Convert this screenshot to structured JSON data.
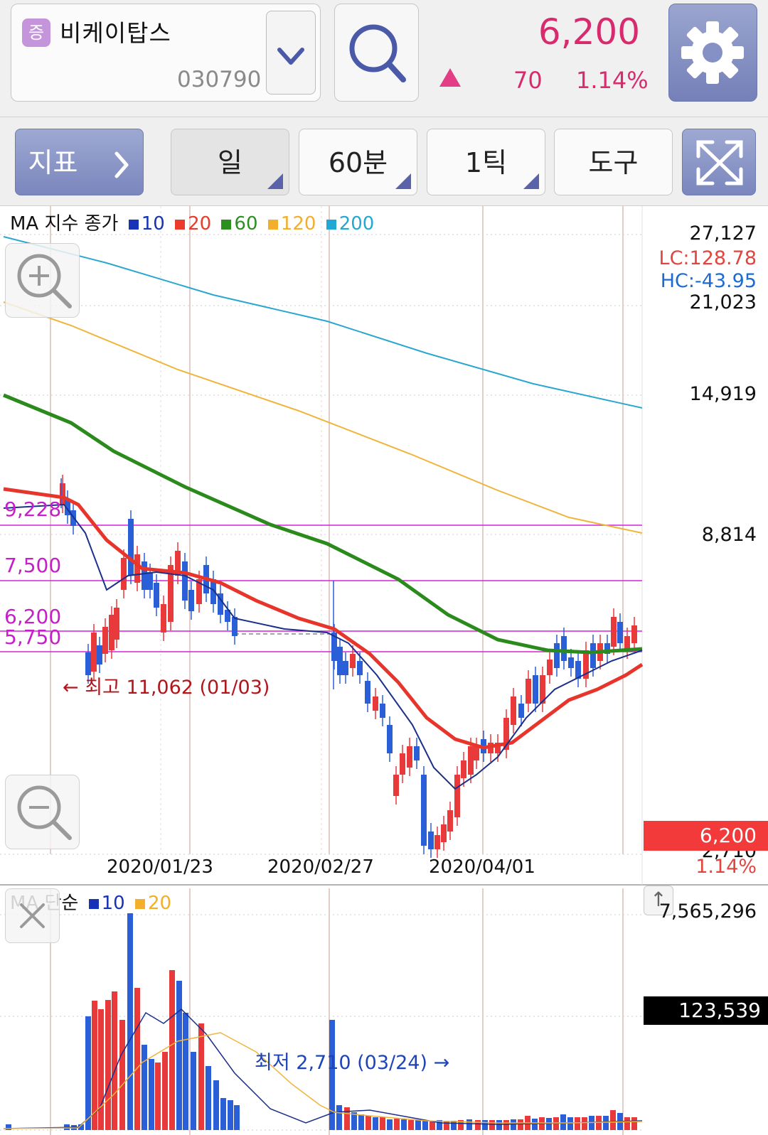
{
  "header": {
    "market_badge": "증",
    "stock_name": "비케이탑스",
    "stock_code": "030790",
    "price": "6,200",
    "change": "70",
    "change_pct": "1.14%"
  },
  "toolbar": {
    "indicator_label": "지표",
    "period_day": "일",
    "period_60min": "60분",
    "tick": "1틱",
    "tools": "도구"
  },
  "colors": {
    "up": "#e8393b",
    "down": "#2a5fd8",
    "ma10": "#1b2f8c",
    "ma20": "#e8352c",
    "ma60": "#2b8a1c",
    "ma120": "#f0b43a",
    "ma200": "#2aa7d0",
    "support_line": "#d622d8"
  },
  "price_legend": {
    "title": "MA 지수 종가",
    "items": [
      {
        "label": "10",
        "color": "#1733b8"
      },
      {
        "label": "20",
        "color": "#ea3b2b"
      },
      {
        "label": "60",
        "color": "#2e8f21"
      },
      {
        "label": "120",
        "color": "#f3ae2c"
      },
      {
        "label": "200",
        "color": "#21a9d3"
      }
    ]
  },
  "volume_legend": {
    "title": "MA 단순",
    "items": [
      {
        "label": "10",
        "color": "#1733b8"
      },
      {
        "label": "20",
        "color": "#f3ae2c"
      }
    ]
  },
  "y_axis": {
    "top": "27,127",
    "lc": "LC:128.78",
    "hc": "HC:-43.95",
    "l2": "21,023",
    "l3": "14,919",
    "l4": "8,814",
    "bottom": "2,710",
    "current": "6,200",
    "current_pct": "1.14%"
  },
  "volume_axis": {
    "top": "7,565,296",
    "current": "123,539"
  },
  "price_labels": {
    "p1": "9,228",
    "p2": "7,500",
    "p3": "6,200",
    "p4": "5,750"
  },
  "x_axis": {
    "d1": "2020/01/23",
    "d2": "2020/02/27",
    "d3": "2020/04/01"
  },
  "annotations": {
    "high": "← 최고 11,062 (01/03)",
    "low": "최저 2,710 (03/24) →"
  },
  "chart_data": {
    "type": "candlestick",
    "title": "",
    "x": [
      "2020/01/23",
      "2020/02/27",
      "2020/04/01"
    ],
    "series": [
      {
        "name": "10",
        "values": []
      },
      {
        "name": "20",
        "values": []
      },
      {
        "name": "60",
        "values": []
      },
      {
        "name": "120",
        "values": []
      },
      {
        "name": "200",
        "values": []
      }
    ],
    "ylim": [
      2710,
      27127
    ],
    "y_ticks": [
      27127,
      21023,
      14919,
      8814,
      2710
    ],
    "y_scale": "log",
    "horizontal_lines": [
      9228,
      7500,
      6200,
      5750
    ],
    "high": {
      "value": 11062,
      "date": "01/03"
    },
    "low": {
      "value": 2710,
      "date": "03/24"
    },
    "current": 6200,
    "volume_max": 7565296,
    "volume_current": 123539,
    "grid": true
  }
}
